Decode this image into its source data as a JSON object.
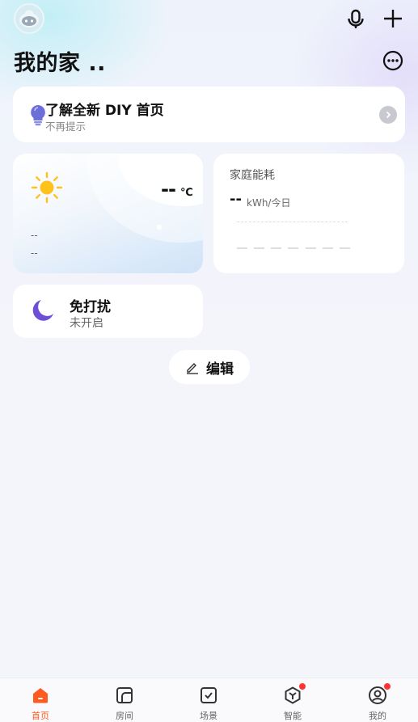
{
  "header": {
    "title": "我的家 ..",
    "icons": [
      "avatar-robot",
      "mic-icon",
      "plus-icon",
      "more-icon"
    ]
  },
  "tip": {
    "title": "了解全新 DIY 首页",
    "subtitle": "不再提示"
  },
  "weather": {
    "temp": "--",
    "unit": "℃",
    "line1": "--",
    "line2": "--"
  },
  "energy": {
    "title": "家庭能耗",
    "value": "--",
    "unit": "kWh/今日"
  },
  "dnd": {
    "title": "免打扰",
    "status": "未开启"
  },
  "edit": {
    "label": "编辑"
  },
  "tabs": [
    {
      "label": "首页",
      "icon": "home-icon",
      "active": true,
      "badge": false
    },
    {
      "label": "房间",
      "icon": "room-icon",
      "active": false,
      "badge": false
    },
    {
      "label": "场景",
      "icon": "scene-icon",
      "active": false,
      "badge": false
    },
    {
      "label": "智能",
      "icon": "smart-icon",
      "active": false,
      "badge": true
    },
    {
      "label": "我的",
      "icon": "profile-icon",
      "active": false,
      "badge": true
    }
  ],
  "colors": {
    "accent": "#ff5a1f",
    "badge": "#ff3333",
    "moon": "#6c4fd6",
    "sun": "#ffc21a",
    "bulb": "#6b6fd9"
  }
}
